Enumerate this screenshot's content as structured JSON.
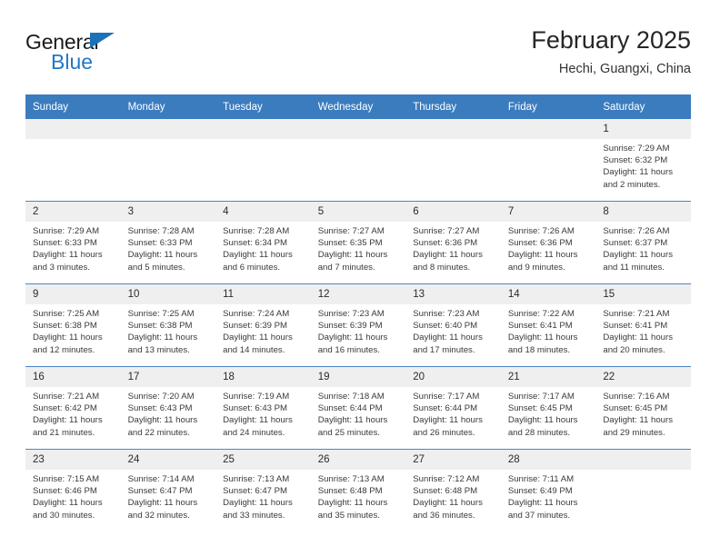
{
  "logo": {
    "word_one": "General",
    "word_two": "Blue",
    "triangle": "triangle-shape",
    "accent_color": "#2277c8"
  },
  "header": {
    "title": "February 2025",
    "location": "Hechi, Guangxi, China"
  },
  "theme": {
    "header_blue": "#3b7cbf",
    "row_divider_blue": "#4b86c2",
    "daynum_band": "#efefef",
    "text": "#3a3a3a"
  },
  "weekdays": [
    "Sunday",
    "Monday",
    "Tuesday",
    "Wednesday",
    "Thursday",
    "Friday",
    "Saturday"
  ],
  "weeks": [
    [
      {
        "day": "",
        "empty": true
      },
      {
        "day": "",
        "empty": true
      },
      {
        "day": "",
        "empty": true
      },
      {
        "day": "",
        "empty": true
      },
      {
        "day": "",
        "empty": true
      },
      {
        "day": "",
        "empty": true
      },
      {
        "day": "1",
        "sunrise": "Sunrise: 7:29 AM",
        "sunset": "Sunset: 6:32 PM",
        "daylight1": "Daylight: 11 hours",
        "daylight2": "and 2 minutes."
      }
    ],
    [
      {
        "day": "2",
        "sunrise": "Sunrise: 7:29 AM",
        "sunset": "Sunset: 6:33 PM",
        "daylight1": "Daylight: 11 hours",
        "daylight2": "and 3 minutes."
      },
      {
        "day": "3",
        "sunrise": "Sunrise: 7:28 AM",
        "sunset": "Sunset: 6:33 PM",
        "daylight1": "Daylight: 11 hours",
        "daylight2": "and 5 minutes."
      },
      {
        "day": "4",
        "sunrise": "Sunrise: 7:28 AM",
        "sunset": "Sunset: 6:34 PM",
        "daylight1": "Daylight: 11 hours",
        "daylight2": "and 6 minutes."
      },
      {
        "day": "5",
        "sunrise": "Sunrise: 7:27 AM",
        "sunset": "Sunset: 6:35 PM",
        "daylight1": "Daylight: 11 hours",
        "daylight2": "and 7 minutes."
      },
      {
        "day": "6",
        "sunrise": "Sunrise: 7:27 AM",
        "sunset": "Sunset: 6:36 PM",
        "daylight1": "Daylight: 11 hours",
        "daylight2": "and 8 minutes."
      },
      {
        "day": "7",
        "sunrise": "Sunrise: 7:26 AM",
        "sunset": "Sunset: 6:36 PM",
        "daylight1": "Daylight: 11 hours",
        "daylight2": "and 9 minutes."
      },
      {
        "day": "8",
        "sunrise": "Sunrise: 7:26 AM",
        "sunset": "Sunset: 6:37 PM",
        "daylight1": "Daylight: 11 hours",
        "daylight2": "and 11 minutes."
      }
    ],
    [
      {
        "day": "9",
        "sunrise": "Sunrise: 7:25 AM",
        "sunset": "Sunset: 6:38 PM",
        "daylight1": "Daylight: 11 hours",
        "daylight2": "and 12 minutes."
      },
      {
        "day": "10",
        "sunrise": "Sunrise: 7:25 AM",
        "sunset": "Sunset: 6:38 PM",
        "daylight1": "Daylight: 11 hours",
        "daylight2": "and 13 minutes."
      },
      {
        "day": "11",
        "sunrise": "Sunrise: 7:24 AM",
        "sunset": "Sunset: 6:39 PM",
        "daylight1": "Daylight: 11 hours",
        "daylight2": "and 14 minutes."
      },
      {
        "day": "12",
        "sunrise": "Sunrise: 7:23 AM",
        "sunset": "Sunset: 6:39 PM",
        "daylight1": "Daylight: 11 hours",
        "daylight2": "and 16 minutes."
      },
      {
        "day": "13",
        "sunrise": "Sunrise: 7:23 AM",
        "sunset": "Sunset: 6:40 PM",
        "daylight1": "Daylight: 11 hours",
        "daylight2": "and 17 minutes."
      },
      {
        "day": "14",
        "sunrise": "Sunrise: 7:22 AM",
        "sunset": "Sunset: 6:41 PM",
        "daylight1": "Daylight: 11 hours",
        "daylight2": "and 18 minutes."
      },
      {
        "day": "15",
        "sunrise": "Sunrise: 7:21 AM",
        "sunset": "Sunset: 6:41 PM",
        "daylight1": "Daylight: 11 hours",
        "daylight2": "and 20 minutes."
      }
    ],
    [
      {
        "day": "16",
        "sunrise": "Sunrise: 7:21 AM",
        "sunset": "Sunset: 6:42 PM",
        "daylight1": "Daylight: 11 hours",
        "daylight2": "and 21 minutes."
      },
      {
        "day": "17",
        "sunrise": "Sunrise: 7:20 AM",
        "sunset": "Sunset: 6:43 PM",
        "daylight1": "Daylight: 11 hours",
        "daylight2": "and 22 minutes."
      },
      {
        "day": "18",
        "sunrise": "Sunrise: 7:19 AM",
        "sunset": "Sunset: 6:43 PM",
        "daylight1": "Daylight: 11 hours",
        "daylight2": "and 24 minutes."
      },
      {
        "day": "19",
        "sunrise": "Sunrise: 7:18 AM",
        "sunset": "Sunset: 6:44 PM",
        "daylight1": "Daylight: 11 hours",
        "daylight2": "and 25 minutes."
      },
      {
        "day": "20",
        "sunrise": "Sunrise: 7:17 AM",
        "sunset": "Sunset: 6:44 PM",
        "daylight1": "Daylight: 11 hours",
        "daylight2": "and 26 minutes."
      },
      {
        "day": "21",
        "sunrise": "Sunrise: 7:17 AM",
        "sunset": "Sunset: 6:45 PM",
        "daylight1": "Daylight: 11 hours",
        "daylight2": "and 28 minutes."
      },
      {
        "day": "22",
        "sunrise": "Sunrise: 7:16 AM",
        "sunset": "Sunset: 6:45 PM",
        "daylight1": "Daylight: 11 hours",
        "daylight2": "and 29 minutes."
      }
    ],
    [
      {
        "day": "23",
        "sunrise": "Sunrise: 7:15 AM",
        "sunset": "Sunset: 6:46 PM",
        "daylight1": "Daylight: 11 hours",
        "daylight2": "and 30 minutes."
      },
      {
        "day": "24",
        "sunrise": "Sunrise: 7:14 AM",
        "sunset": "Sunset: 6:47 PM",
        "daylight1": "Daylight: 11 hours",
        "daylight2": "and 32 minutes."
      },
      {
        "day": "25",
        "sunrise": "Sunrise: 7:13 AM",
        "sunset": "Sunset: 6:47 PM",
        "daylight1": "Daylight: 11 hours",
        "daylight2": "and 33 minutes."
      },
      {
        "day": "26",
        "sunrise": "Sunrise: 7:13 AM",
        "sunset": "Sunset: 6:48 PM",
        "daylight1": "Daylight: 11 hours",
        "daylight2": "and 35 minutes."
      },
      {
        "day": "27",
        "sunrise": "Sunrise: 7:12 AM",
        "sunset": "Sunset: 6:48 PM",
        "daylight1": "Daylight: 11 hours",
        "daylight2": "and 36 minutes."
      },
      {
        "day": "28",
        "sunrise": "Sunrise: 7:11 AM",
        "sunset": "Sunset: 6:49 PM",
        "daylight1": "Daylight: 11 hours",
        "daylight2": "and 37 minutes."
      },
      {
        "day": "",
        "empty": true
      }
    ]
  ]
}
